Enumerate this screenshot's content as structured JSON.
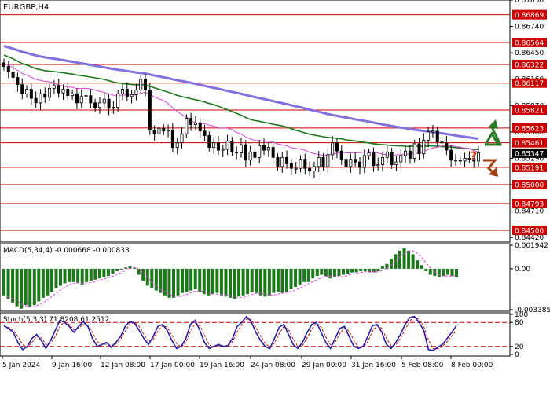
{
  "chart_data": {
    "type": "candlestick",
    "symbol_title": "EURGBP,H4",
    "colors": {
      "background": "#ffffff",
      "candle": "#000000",
      "level_line": "#cc0000",
      "level_label_bg": "#cc0000",
      "price_label_bg": "#000000",
      "ma_fast": "#e040e0",
      "ma_mid": "#1a7a1a",
      "ma_slow": "#8070e0",
      "macd_hist": "#1a7a1a",
      "macd_signal": "#e040e0",
      "stoch_main": "#1f1fb0",
      "stoch_signal": "#cc0000",
      "arrow_up": "#2a7a2a",
      "arrow_down": "#a0401a",
      "question_mark": "#cc4422"
    },
    "price_axis": {
      "range": [
        0.8437,
        0.8703
      ],
      "ticks": [
        "0.87030",
        "0.86740",
        "0.86450",
        "0.86160",
        "0.85870",
        "0.85580",
        "0.85290",
        "0.85000",
        "0.84710",
        "0.84420"
      ]
    },
    "levels": [
      "0.86869",
      "0.86564",
      "0.86322",
      "0.86117",
      "0.85821",
      "0.85623",
      "0.85461",
      "0.85191",
      "0.85000",
      "0.84793",
      "0.84500"
    ],
    "current_price": "0.85347",
    "current_price_value": 0.85347,
    "x_labels": [
      "5 Jan 2024",
      "9 Jan 16:00",
      "12 Jan 08:00",
      "17 Jan 00:00",
      "19 Jan 16:00",
      "24 Jan 08:00",
      "29 Jan 00:00",
      "31 Jan 16:00",
      "5 Feb 08:00",
      "8 Feb 00:00"
    ],
    "candles_close": [
      0.863,
      0.8624,
      0.8618,
      0.861,
      0.86,
      0.8605,
      0.8595,
      0.859,
      0.86,
      0.8596,
      0.8606,
      0.8609,
      0.8601,
      0.8605,
      0.8598,
      0.86,
      0.859,
      0.8597,
      0.8598,
      0.859,
      0.8585,
      0.859,
      0.8594,
      0.8584,
      0.8585,
      0.86,
      0.8605,
      0.8597,
      0.8599,
      0.8604,
      0.8616,
      0.8604,
      0.856,
      0.8556,
      0.8562,
      0.8559,
      0.856,
      0.8541,
      0.8546,
      0.8556,
      0.8573,
      0.8566,
      0.8568,
      0.8559,
      0.8554,
      0.8541,
      0.8546,
      0.8538,
      0.8539,
      0.8548,
      0.8536,
      0.8535,
      0.8544,
      0.8527,
      0.8536,
      0.853,
      0.8543,
      0.8538,
      0.8541,
      0.853,
      0.852,
      0.853,
      0.8523,
      0.8518,
      0.8518,
      0.8528,
      0.8518,
      0.8515,
      0.852,
      0.853,
      0.852,
      0.8533,
      0.8546,
      0.8537,
      0.8528,
      0.852,
      0.8528,
      0.8525,
      0.8519,
      0.8532,
      0.8535,
      0.8521,
      0.8522,
      0.853,
      0.8536,
      0.8522,
      0.8525,
      0.8532,
      0.8537,
      0.8529,
      0.8545,
      0.8534,
      0.8549,
      0.8558,
      0.8559,
      0.8547,
      0.8546,
      0.8538,
      0.8527,
      0.8527,
      0.8526,
      0.8529,
      0.8529,
      0.8526,
      0.8535
    ],
    "moving_averages": [
      {
        "key": "ma_slow",
        "start": 0.866,
        "end": 0.8557
      },
      {
        "key": "ma_mid",
        "start": 0.8658,
        "end": 0.8543
      },
      {
        "key": "ma_fast",
        "start": 0.865,
        "end": 0.8537
      }
    ],
    "macd": {
      "title": "MACD(5,34,4) -0.000668 -0.000833",
      "ticks": [
        "0.001942",
        "0.00",
        "-0.003385"
      ],
      "range": [
        -0.003385,
        0.001942
      ],
      "histogram": [
        -0.0022,
        -0.0025,
        -0.0028,
        -0.0031,
        -0.0033,
        -0.003,
        -0.0032,
        -0.003,
        -0.0027,
        -0.0024,
        -0.0022,
        -0.0019,
        -0.0016,
        -0.0014,
        -0.0012,
        -0.0011,
        -0.0011,
        -0.0012,
        -0.0013,
        -0.0011,
        -0.001,
        -0.0009,
        -0.0008,
        -0.0007,
        -0.0006,
        -0.0004,
        -0.0002,
        0.0,
        0.0001,
        0.0002,
        0.0001,
        -0.0005,
        -0.001,
        -0.0014,
        -0.0016,
        -0.0018,
        -0.002,
        -0.0022,
        -0.0024,
        -0.0024,
        -0.0022,
        -0.002,
        -0.0019,
        -0.0018,
        -0.0017,
        -0.0019,
        -0.0021,
        -0.0022,
        -0.0021,
        -0.002,
        -0.0022,
        -0.0023,
        -0.0024,
        -0.0025,
        -0.0023,
        -0.0022,
        -0.0021,
        -0.0019,
        -0.002,
        -0.0022,
        -0.0023,
        -0.0022,
        -0.002,
        -0.0019,
        -0.002,
        -0.0019,
        -0.0017,
        -0.0015,
        -0.0013,
        -0.0011,
        -0.0011,
        -0.0008,
        -0.0006,
        -0.0005,
        -0.0006,
        -0.0008,
        -0.0007,
        -0.0006,
        -0.0005,
        -0.0004,
        -0.0003,
        -0.0003,
        -0.0002,
        -0.0002,
        -0.0003,
        -0.0003,
        -0.0002,
        0.0002,
        0.0004,
        0.0008,
        0.0012,
        0.0015,
        0.0017,
        0.0015,
        0.0012,
        0.0007,
        0.0003,
        -0.0002,
        -0.0005,
        -0.0006,
        -0.0007,
        -0.0006,
        -0.0005,
        -0.0006,
        -0.0007
      ]
    },
    "stochastic": {
      "title": "Stoch(5,3,3) 71.8208 61.2512",
      "ticks": [
        "100",
        "80",
        "20",
        "0"
      ],
      "levels": [
        80,
        20
      ],
      "range": [
        0,
        100
      ],
      "main": [
        72,
        65,
        55,
        30,
        12,
        20,
        40,
        50,
        35,
        15,
        35,
        60,
        85,
        80,
        70,
        55,
        70,
        82,
        70,
        40,
        20,
        25,
        30,
        18,
        30,
        45,
        70,
        82,
        78,
        60,
        40,
        25,
        45,
        70,
        75,
        60,
        35,
        15,
        20,
        40,
        75,
        85,
        60,
        30,
        15,
        20,
        25,
        20,
        22,
        40,
        70,
        80,
        95,
        82,
        55,
        35,
        20,
        15,
        40,
        68,
        75,
        50,
        25,
        15,
        30,
        55,
        75,
        80,
        55,
        30,
        15,
        40,
        65,
        70,
        45,
        20,
        15,
        20,
        45,
        72,
        75,
        55,
        25,
        15,
        30,
        50,
        75,
        92,
        95,
        80,
        60,
        12,
        10,
        18,
        25,
        40,
        55,
        72
      ],
      "signal": [
        70,
        68,
        60,
        45,
        25,
        18,
        30,
        45,
        42,
        25,
        28,
        45,
        70,
        82,
        75,
        62,
        66,
        75,
        72,
        55,
        32,
        24,
        26,
        22,
        26,
        38,
        58,
        76,
        80,
        70,
        50,
        32,
        38,
        58,
        72,
        68,
        48,
        28,
        18,
        30,
        58,
        78,
        72,
        48,
        24,
        18,
        22,
        22,
        21,
        32,
        56,
        74,
        88,
        88,
        68,
        46,
        28,
        18,
        28,
        52,
        70,
        62,
        38,
        20,
        22,
        42,
        64,
        78,
        68,
        44,
        24,
        30,
        52,
        66,
        58,
        35,
        18,
        18,
        32,
        58,
        72,
        65,
        40,
        22,
        24,
        40,
        62,
        84,
        94,
        88,
        70,
        36,
        14,
        14,
        20,
        32,
        46,
        61
      ]
    }
  }
}
